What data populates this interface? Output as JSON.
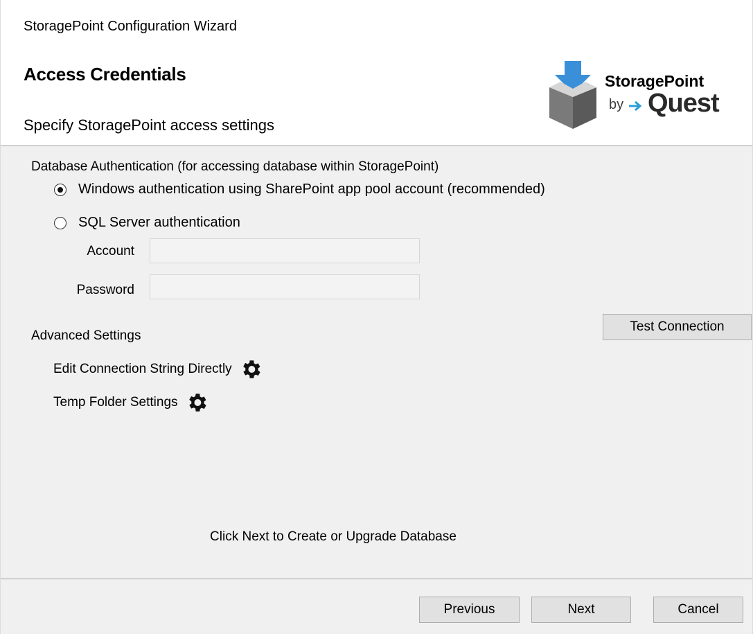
{
  "window": {
    "title": "StoragePoint Configuration Wizard"
  },
  "header": {
    "title": "Access Credentials",
    "subtitle": "Specify StoragePoint access settings",
    "logo": {
      "name": "StoragePoint",
      "by": "by",
      "brand": "Quest",
      "icon": "box-download-icon"
    }
  },
  "auth": {
    "section_label": "Database Authentication (for accessing database within StoragePoint)",
    "options": [
      {
        "label": "Windows authentication using SharePoint app pool account (recommended)",
        "selected": true
      },
      {
        "label": "SQL Server authentication",
        "selected": false
      }
    ],
    "account_label": "Account",
    "account_value": "",
    "password_label": "Password",
    "password_value": ""
  },
  "test_connection_label": "Test Connection",
  "advanced": {
    "section_label": "Advanced Settings",
    "items": [
      {
        "label": "Edit Connection String Directly",
        "icon": "gear-icon"
      },
      {
        "label": "Temp Folder Settings",
        "icon": "gear-icon"
      }
    ]
  },
  "note": "Click Next to Create or Upgrade Database",
  "footer": {
    "previous_label": "Previous",
    "next_label": "Next",
    "cancel_label": "Cancel"
  }
}
